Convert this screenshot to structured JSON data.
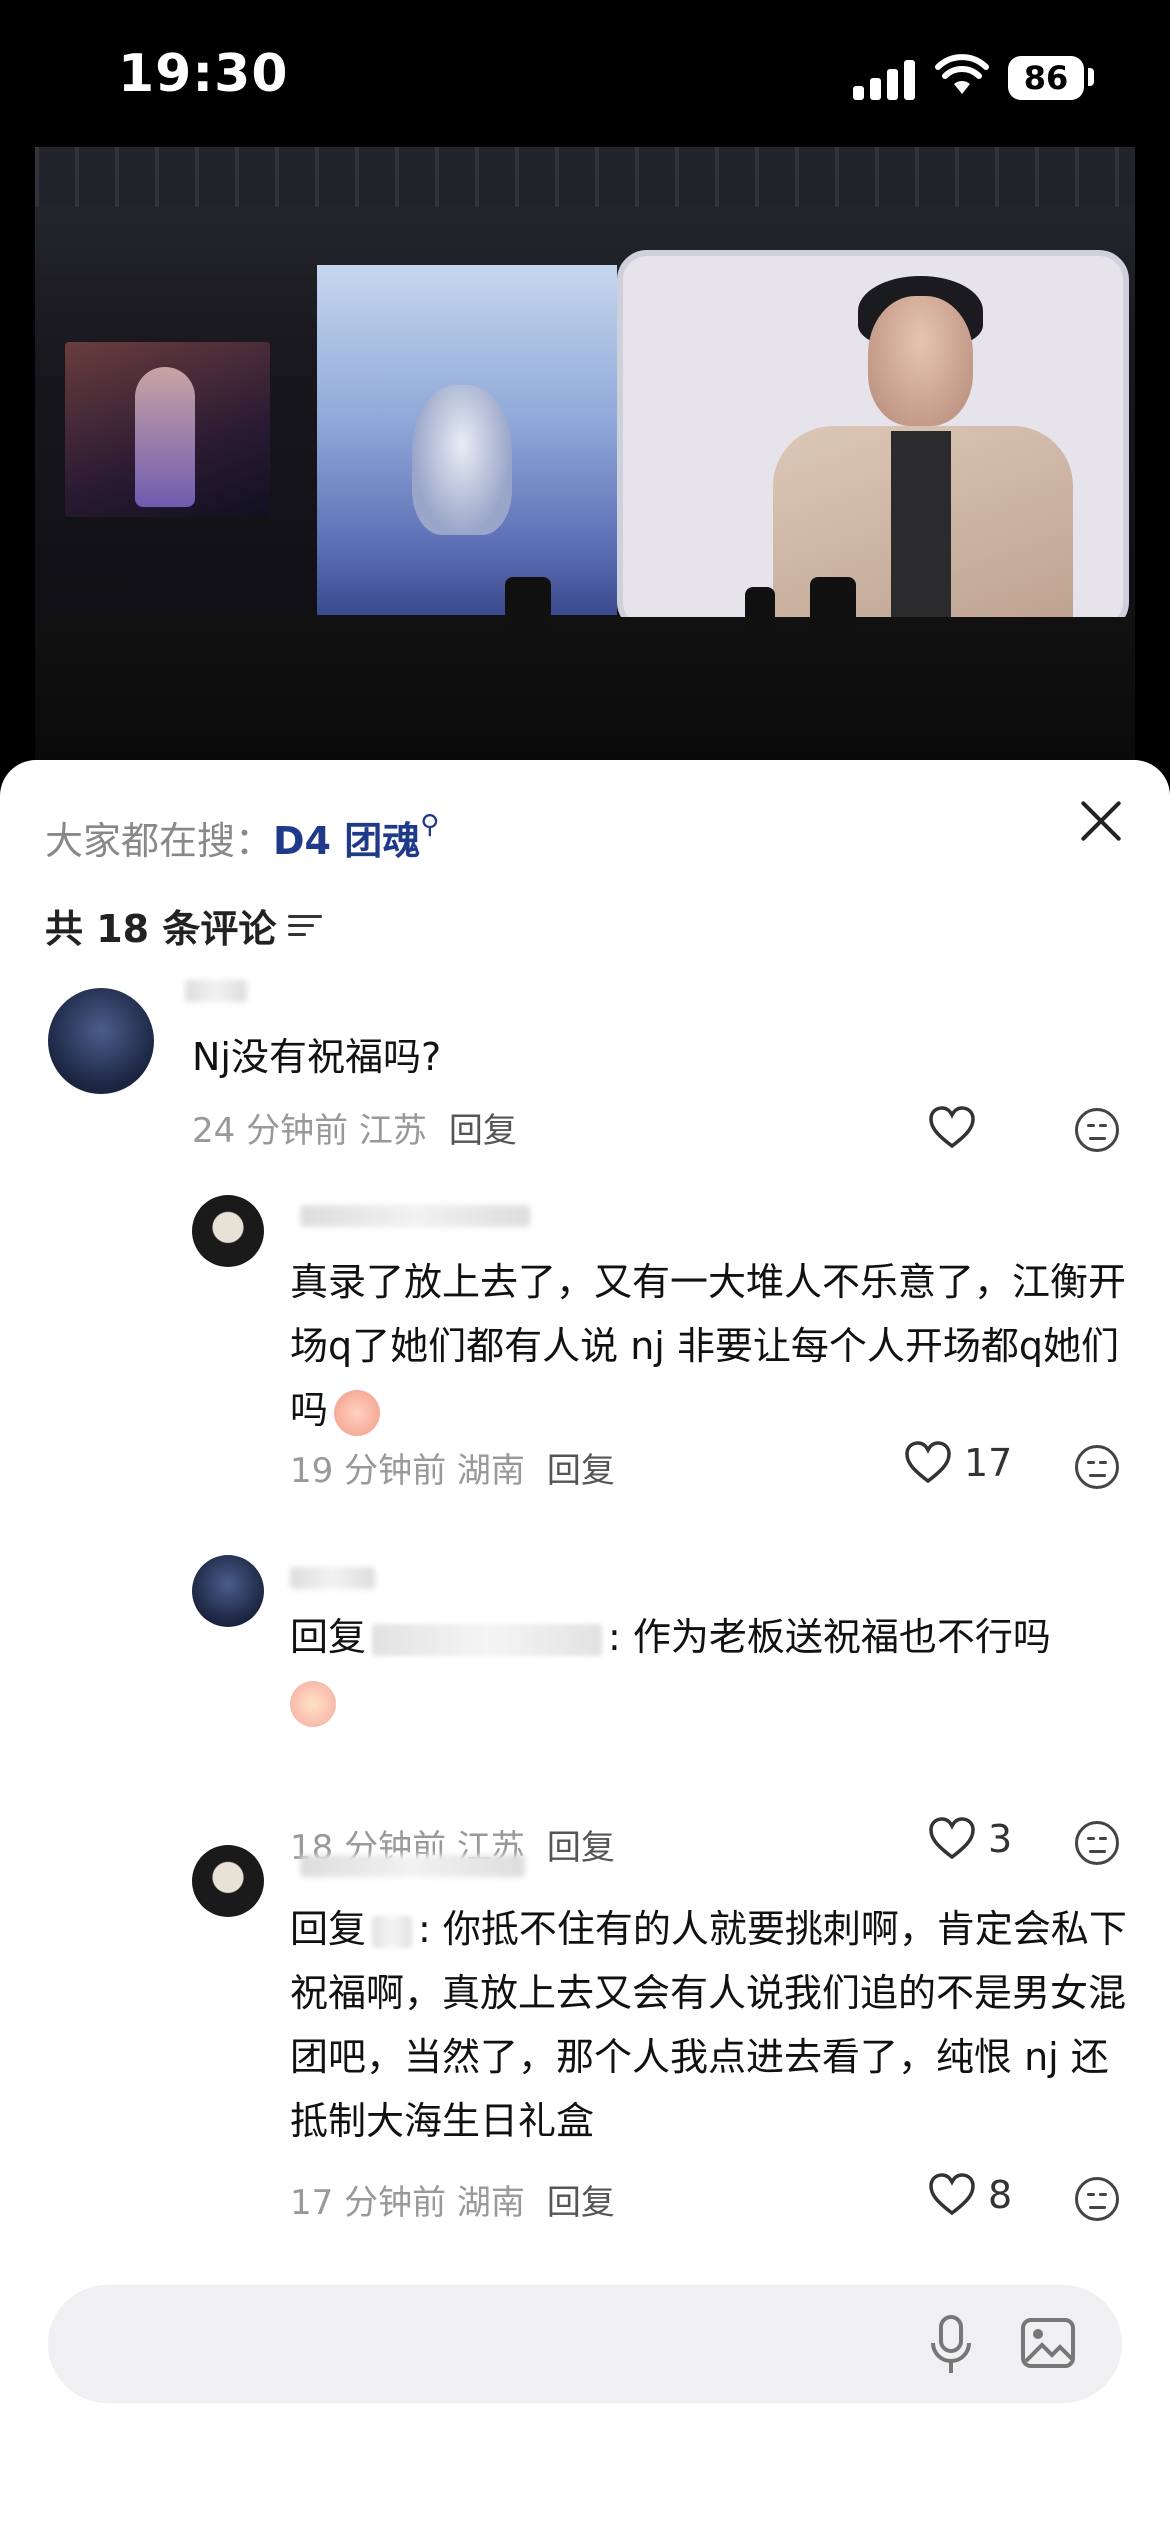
{
  "status": {
    "time": "19:30",
    "battery": "86"
  },
  "sheet": {
    "search_prefix": "大家都在搜：",
    "search_keyword": "D4 团魂",
    "comment_count": "共 18 条评论"
  },
  "comments": [
    {
      "text": "Nj没有祝福吗?",
      "time": "24 分钟前",
      "location": "江苏",
      "reply": "回复",
      "likes": ""
    },
    {
      "text": "真录了放上去了，又有一大堆人不乐意了，江衡开场q了她们都有人说 nj 非要让每个人开场都q她们吗",
      "time": "19 分钟前",
      "location": "湖南",
      "reply": "回复",
      "likes": "17"
    },
    {
      "prefix": "回复",
      "text": ": 作为老板送祝福也不行吗",
      "time": "18 分钟前",
      "location": "江苏",
      "reply": "回复",
      "likes": "3"
    },
    {
      "prefix": "回复",
      "text": ": 你抵不住有的人就要挑刺啊，肯定会私下祝福啊，真放上去又会有人说我们追的不是男女混团吧，当然了，那个人我点进去看了，纯恨 nj 还抵制大海生日礼盒",
      "time": "17 分钟前",
      "location": "湖南",
      "reply": "回复",
      "likes": "8"
    }
  ],
  "icons": [
    "search-icon",
    "close-icon",
    "filter-icon",
    "heart-icon",
    "dislike-icon",
    "mic-icon",
    "image-icon"
  ]
}
